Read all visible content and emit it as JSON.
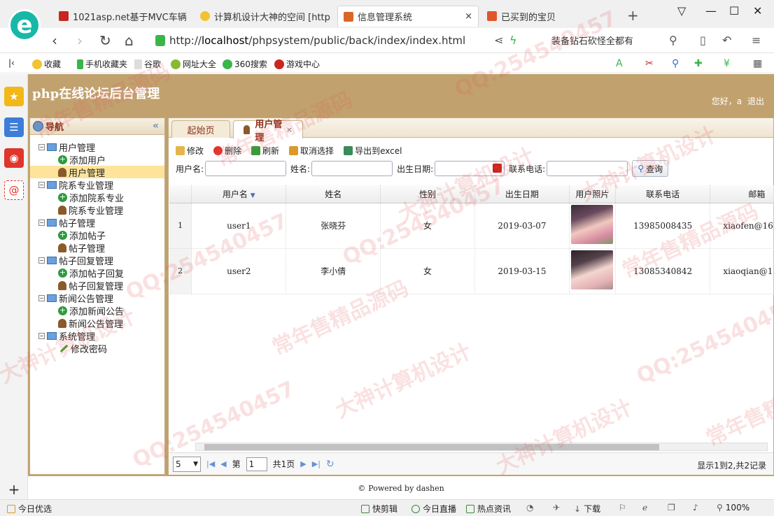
{
  "browser": {
    "tabs": [
      {
        "title": "1021asp.net基于MVC车辆"
      },
      {
        "title": "计算机设计大神的空间 [http"
      },
      {
        "title": "信息管理系统"
      },
      {
        "title": "已买到的宝贝"
      }
    ],
    "url_prefix": "http://",
    "url_host": "localhost",
    "url_path": "/phpsystem/public/back/index/index.html",
    "search_hint": "装备钻石砍怪全都有",
    "bookmarks": [
      {
        "label": "收藏"
      },
      {
        "label": "手机收藏夹"
      },
      {
        "label": "谷歌"
      },
      {
        "label": "网址大全"
      },
      {
        "label": "360搜索"
      },
      {
        "label": "游戏中心"
      }
    ],
    "status": {
      "left": "今日优选",
      "items": [
        "快剪辑",
        "今日直播",
        "热点资讯",
        "下载"
      ],
      "zoom": "100%"
    }
  },
  "app": {
    "title": "php在线论坛后台管理",
    "greeting": "您好，a",
    "logout": "退出",
    "footer": "Powered by dashen"
  },
  "nav": {
    "title": "导航",
    "groups": [
      {
        "label": "用户管理",
        "children": [
          {
            "label": "添加用户",
            "icon": "add"
          },
          {
            "label": "用户管理",
            "icon": "user",
            "selected": true
          }
        ]
      },
      {
        "label": "院系专业管理",
        "children": [
          {
            "label": "添加院系专业",
            "icon": "add"
          },
          {
            "label": "院系专业管理",
            "icon": "user"
          }
        ]
      },
      {
        "label": "帖子管理",
        "children": [
          {
            "label": "添加帖子",
            "icon": "add"
          },
          {
            "label": "帖子管理",
            "icon": "user"
          }
        ]
      },
      {
        "label": "帖子回复管理",
        "children": [
          {
            "label": "添加帖子回复",
            "icon": "add"
          },
          {
            "label": "帖子回复管理",
            "icon": "user"
          }
        ]
      },
      {
        "label": "新闻公告管理",
        "children": [
          {
            "label": "添加新闻公告",
            "icon": "add"
          },
          {
            "label": "新闻公告管理",
            "icon": "user"
          }
        ]
      },
      {
        "label": "系统管理",
        "children": [
          {
            "label": "修改密码",
            "icon": "pencil"
          }
        ]
      }
    ]
  },
  "main": {
    "tabs": [
      {
        "label": "起始页"
      },
      {
        "label": "用户管理",
        "closable": true
      }
    ],
    "toolbar": {
      "edit": "修改",
      "delete": "删除",
      "refresh": "刷新",
      "unselect": "取消选择",
      "export": "导出到excel"
    },
    "search": {
      "username_label": "用户名:",
      "name_label": "姓名:",
      "birth_label": "出生日期:",
      "phone_label": "联系电话:",
      "query": "查询"
    },
    "columns": [
      "用户名",
      "姓名",
      "性别",
      "出生日期",
      "用户照片",
      "联系电话",
      "邮箱"
    ],
    "rows": [
      {
        "no": "1",
        "username": "user1",
        "name": "张晓芬",
        "gender": "女",
        "birth": "2019-03-07",
        "phone": "13985008435",
        "email": "xiaofen@16"
      },
      {
        "no": "2",
        "username": "user2",
        "name": "李小倩",
        "gender": "女",
        "birth": "2019-03-15",
        "phone": "13085340842",
        "email": "xiaoqian@1"
      }
    ],
    "pager": {
      "page_size": "5",
      "page_label": "第",
      "page_value": "1",
      "total_pages": "共1页",
      "info": "显示1到2,共2记录"
    }
  },
  "watermark": [
    "QQ:254540457",
    "常年售精品源码",
    "大神计算机设计"
  ]
}
